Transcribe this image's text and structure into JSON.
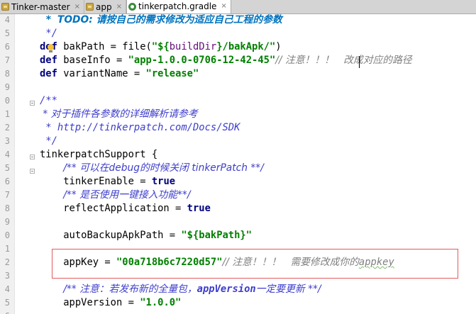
{
  "tabs": [
    {
      "label": "Tinker-master",
      "icon": "folder-icon",
      "active": false
    },
    {
      "label": "app",
      "icon": "folder-icon",
      "active": false
    },
    {
      "label": "tinkerpatch.gradle",
      "icon": "gradle-icon",
      "active": true
    }
  ],
  "tab_close_glyph": "×",
  "line_numbers": [
    "4",
    "5",
    "6",
    "7",
    "8",
    "9",
    "0",
    "1",
    "2",
    "3",
    "4",
    "5",
    "6",
    "7",
    "8",
    "9",
    "0",
    "1",
    "2",
    "3",
    "4",
    "5",
    "6"
  ],
  "code": {
    "l1": {
      "star": " * ",
      "todo": "TODO: 请按自己的需求修改为适应自己工程的参数"
    },
    "l2": {
      "text": " */"
    },
    "l3": {
      "kw": "def",
      "pre": " bakPath = file(",
      "q1": "\"${",
      "ivar": "buildDir",
      "q2": "}/bakApk/\"",
      "post": ")"
    },
    "l4": {
      "kw": "def",
      "pre": " baseInfo = ",
      "str": "\"app-1.0.0-0706-12-42-45\"",
      "cmt": "// 注意！！！   改成对应的路径"
    },
    "l5": {
      "kw": "def",
      "pre": " variantName = ",
      "str": "\"release\""
    },
    "l6": {
      "text": ""
    },
    "l7": {
      "text": "/**"
    },
    "l8": {
      "text": " * 对于插件各参数的详细解析请参考"
    },
    "l9": {
      "text": " * http://tinkerpatch.com/Docs/SDK"
    },
    "l10": {
      "text": " */"
    },
    "l11": {
      "text": "tinkerpatchSupport {"
    },
    "l12": {
      "pre": "    ",
      "doc": "/** 可以在debug的时候关闭 tinkerPatch **/"
    },
    "l13": {
      "pre": "    tinkerEnable = ",
      "kw": "true"
    },
    "l14": {
      "pre": "    ",
      "doc": "/** 是否使用一键接入功能**/"
    },
    "l15": {
      "pre": "    reflectApplication = ",
      "kw": "true"
    },
    "l16": {
      "text": ""
    },
    "l17": {
      "pre": "    autoBackupApkPath = ",
      "str": "\"${bakPath}\""
    },
    "l18": {
      "text": ""
    },
    "l19": {
      "pre": "    appKey = ",
      "str": "\"00a718b6c7220d57\"",
      "cmt": "// 注意！！！   需要修改成你的",
      "typo": "appkey"
    },
    "l20": {
      "text": ""
    },
    "l21": {
      "pre": "    ",
      "doc": "/** 注意：若发布新的全量包，",
      "docb": "appVersion",
      "doc2": "一定要更新 **/"
    },
    "l22": {
      "pre": "    appVersion = ",
      "str": "\"1.0.0\""
    }
  },
  "colors": {
    "keyword": "#000080",
    "string": "#008000",
    "comment": "#808080",
    "doc": "#3d3dcc",
    "highlight_box": "#e45a5a"
  }
}
